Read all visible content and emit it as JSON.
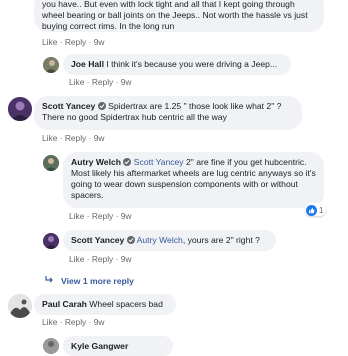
{
  "comments": {
    "top": {
      "text": "you have.. But even with lock tight and all that I kept going through wheel bearing or ball joints on the Jeeps.. Not worth the hassle vs just buying correct rims. In the long run",
      "like": "Like",
      "reply": "Reply",
      "time": "9w"
    },
    "joe": {
      "author": "Joe Hall",
      "text": "I think it's because you were driving a Jeep...",
      "like": "Like",
      "reply": "Reply",
      "time": "9w"
    },
    "scott1": {
      "author": "Scott Yancey",
      "text": "Spidertrax are 1.25 \" those look like what 2\" ? There no good Spidertrax hub centric all the way",
      "like": "Like",
      "reply": "Reply",
      "time": "9w"
    },
    "autry": {
      "author": "Autry Welch",
      "mention": "Scott Yancey",
      "text": "2\" are fine if you get hubcentric. Most likely his aftermarket wheels are lug centric anyways so it's going to wear down suspension components with or without spacers.",
      "like": "Like",
      "reply": "Reply",
      "time": "9w",
      "reaction_count": "1"
    },
    "scott2": {
      "author": "Scott Yancey",
      "mention": "Autry Welch",
      "text": ", yours are 2\" right ?",
      "like": "Like",
      "reply": "Reply",
      "time": "9w"
    },
    "view_more": "View 1 more reply",
    "paul": {
      "author": "Paul Carah",
      "text": "Wheel spacers bad",
      "like": "Like",
      "reply": "Reply",
      "time": "9w"
    },
    "kyle": {
      "author": "Kyle Gangwer"
    }
  },
  "colors": {
    "link": "#385898",
    "bubble": "#f0f2f5",
    "meta": "#65676b"
  }
}
